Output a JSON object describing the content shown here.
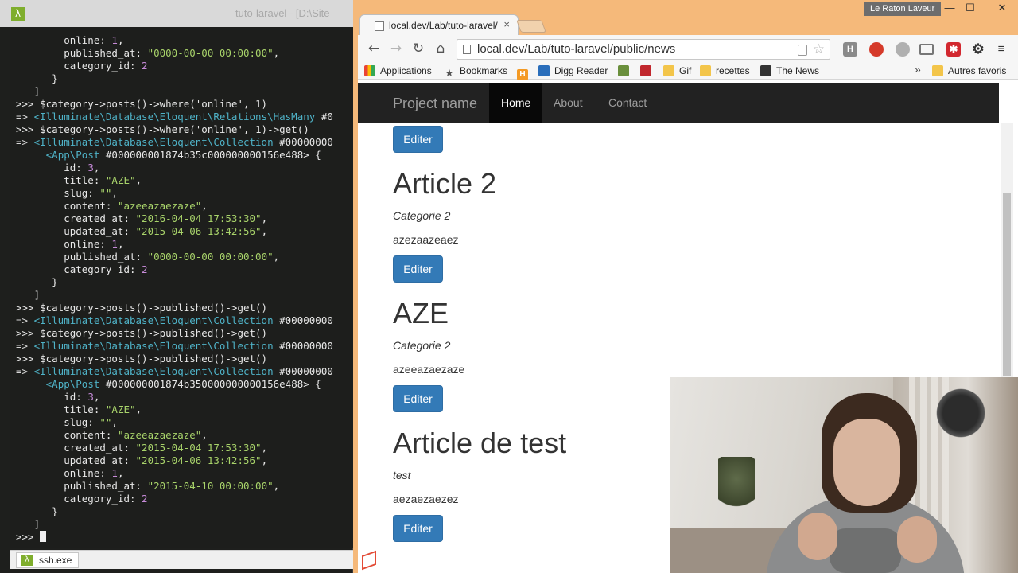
{
  "terminal": {
    "title": "tuto-laravel - [D:\\Site",
    "lines": [
      [
        {
          "t": "        online: "
        },
        {
          "t": "1",
          "c": "num"
        },
        {
          "t": ","
        }
      ],
      [
        {
          "t": "        published_at: "
        },
        {
          "t": "\"0000-00-00 00:00:00\"",
          "c": "str"
        },
        {
          "t": ","
        }
      ],
      [
        {
          "t": "        category_id: "
        },
        {
          "t": "2",
          "c": "num"
        }
      ],
      [
        {
          "t": "      }"
        }
      ],
      [
        {
          "t": "   ]"
        }
      ],
      [
        {
          "t": ">>> $category->posts()->where('online', 1)"
        }
      ],
      [
        {
          "t": "=> ",
          "c": "arrow"
        },
        {
          "t": "<Illuminate\\Database\\Eloquent\\Relations\\HasMany",
          "c": "cls"
        },
        {
          "t": " #0"
        }
      ],
      [
        {
          "t": ">>> $category->posts()->where('online', 1)->get()"
        }
      ],
      [
        {
          "t": "=> ",
          "c": "arrow"
        },
        {
          "t": "<Illuminate\\Database\\Eloquent\\Collection",
          "c": "cls"
        },
        {
          "t": " #00000000"
        }
      ],
      [
        {
          "t": "     "
        },
        {
          "t": "<App\\Post",
          "c": "cls"
        },
        {
          "t": " #000000001874b35c000000000156e488> {"
        }
      ],
      [
        {
          "t": "        id: "
        },
        {
          "t": "3",
          "c": "num"
        },
        {
          "t": ","
        }
      ],
      [
        {
          "t": "        title: "
        },
        {
          "t": "\"AZE\"",
          "c": "str"
        },
        {
          "t": ","
        }
      ],
      [
        {
          "t": "        slug: "
        },
        {
          "t": "\"\"",
          "c": "str"
        },
        {
          "t": ","
        }
      ],
      [
        {
          "t": "        content: "
        },
        {
          "t": "\"azeeazaezaze\"",
          "c": "str"
        },
        {
          "t": ","
        }
      ],
      [
        {
          "t": "        created_at: "
        },
        {
          "t": "\"2016-04-04 17:53:30\"",
          "c": "str"
        },
        {
          "t": ","
        }
      ],
      [
        {
          "t": "        updated_at: "
        },
        {
          "t": "\"2015-04-06 13:42:56\"",
          "c": "str"
        },
        {
          "t": ","
        }
      ],
      [
        {
          "t": "        online: "
        },
        {
          "t": "1",
          "c": "num"
        },
        {
          "t": ","
        }
      ],
      [
        {
          "t": "        published_at: "
        },
        {
          "t": "\"0000-00-00 00:00:00\"",
          "c": "str"
        },
        {
          "t": ","
        }
      ],
      [
        {
          "t": "        category_id: "
        },
        {
          "t": "2",
          "c": "num"
        }
      ],
      [
        {
          "t": "      }"
        }
      ],
      [
        {
          "t": "   ]"
        }
      ],
      [
        {
          "t": ">>> $category->posts()->published()->get()"
        }
      ],
      [
        {
          "t": "=> ",
          "c": "arrow"
        },
        {
          "t": "<Illuminate\\Database\\Eloquent\\Collection",
          "c": "cls"
        },
        {
          "t": " #00000000"
        }
      ],
      [
        {
          "t": ">>> $category->posts()->published()->get()"
        }
      ],
      [
        {
          "t": "=> ",
          "c": "arrow"
        },
        {
          "t": "<Illuminate\\Database\\Eloquent\\Collection",
          "c": "cls"
        },
        {
          "t": " #00000000"
        }
      ],
      [
        {
          "t": ">>> $category->posts()->published()->get()"
        }
      ],
      [
        {
          "t": "=> ",
          "c": "arrow"
        },
        {
          "t": "<Illuminate\\Database\\Eloquent\\Collection",
          "c": "cls"
        },
        {
          "t": " #00000000"
        }
      ],
      [
        {
          "t": "     "
        },
        {
          "t": "<App\\Post",
          "c": "cls"
        },
        {
          "t": " #000000001874b350000000000156e488> {"
        }
      ],
      [
        {
          "t": "        id: "
        },
        {
          "t": "3",
          "c": "num"
        },
        {
          "t": ","
        }
      ],
      [
        {
          "t": "        title: "
        },
        {
          "t": "\"AZE\"",
          "c": "str"
        },
        {
          "t": ","
        }
      ],
      [
        {
          "t": "        slug: "
        },
        {
          "t": "\"\"",
          "c": "str"
        },
        {
          "t": ","
        }
      ],
      [
        {
          "t": "        content: "
        },
        {
          "t": "\"azeeazaezaze\"",
          "c": "str"
        },
        {
          "t": ","
        }
      ],
      [
        {
          "t": "        created_at: "
        },
        {
          "t": "\"2015-04-04 17:53:30\"",
          "c": "str"
        },
        {
          "t": ","
        }
      ],
      [
        {
          "t": "        updated_at: "
        },
        {
          "t": "\"2015-04-06 13:42:56\"",
          "c": "str"
        },
        {
          "t": ","
        }
      ],
      [
        {
          "t": "        online: "
        },
        {
          "t": "1",
          "c": "num"
        },
        {
          "t": ","
        }
      ],
      [
        {
          "t": "        published_at: "
        },
        {
          "t": "\"2015-04-10 00:00:00\"",
          "c": "str"
        },
        {
          "t": ","
        }
      ],
      [
        {
          "t": "        category_id: "
        },
        {
          "t": "2",
          "c": "num"
        }
      ],
      [
        {
          "t": "      }"
        }
      ],
      [
        {
          "t": "   ]"
        }
      ]
    ],
    "prompt": ">>> ",
    "taskbar_tab": "ssh.exe"
  },
  "browser": {
    "tab_title": "local.dev/Lab/tuto-laravel/",
    "tab_close": "×",
    "profile_name": "Le Raton Laveur",
    "window_controls": {
      "minimize": "—",
      "maximize": "☐",
      "close": "✕"
    },
    "url": "local.dev/Lab/tuto-laravel/public/news",
    "nav_icons": {
      "back": "←",
      "forward": "→",
      "reload": "↻",
      "home": "⌂",
      "star": "☆",
      "more": "»"
    },
    "extensions": {
      "h": "H",
      "star_ext": "✱",
      "gear": "⚙",
      "menu": "≡"
    },
    "bookmarks": [
      {
        "label": "Applications",
        "icon": "apps-icon"
      },
      {
        "label": "Bookmarks",
        "icon": "star-icon"
      },
      {
        "label": "",
        "icon": "h-icon"
      },
      {
        "label": "Digg Reader",
        "icon": "digg-icon"
      },
      {
        "label": "",
        "icon": "shield-icon"
      },
      {
        "label": "",
        "icon": "redbox-icon"
      },
      {
        "label": "Gif",
        "icon": "folder-icon"
      },
      {
        "label": "recettes",
        "icon": "folder-icon"
      },
      {
        "label": "The News",
        "icon": "news-icon"
      }
    ],
    "other_bookmarks": "Autres favoris"
  },
  "site": {
    "brand": "Project name",
    "nav": {
      "home": "Home",
      "about": "About",
      "contact": "Contact"
    },
    "edit_label": "Editer",
    "articles": [
      {
        "title": "Article 2",
        "category": "Categorie 2",
        "content": "azezaazeaez"
      },
      {
        "title": "AZE",
        "category": "Categorie 2",
        "content": "azeeazaezaze"
      },
      {
        "title": "Article de test",
        "category": "test",
        "content": "aezaezaezez"
      }
    ]
  },
  "colors": {
    "browser_frame": "#f5b97a",
    "navbar_bg": "#222222",
    "button_primary": "#337ab7",
    "terminal_bg": "#1d1e1c"
  }
}
